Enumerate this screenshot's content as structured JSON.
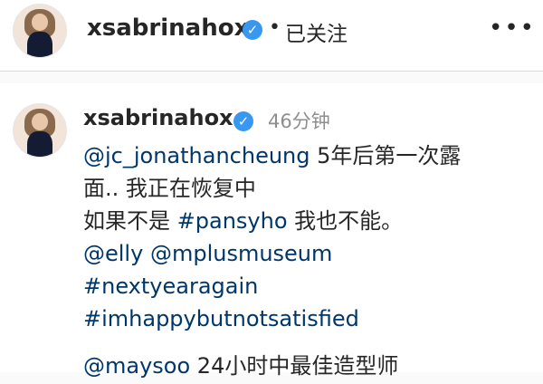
{
  "post_header": {
    "username": "xsabrinahox",
    "verified_glyph": "✓",
    "separator": "•",
    "follow_status": "已关注",
    "more_glyph": "•••"
  },
  "comment": {
    "username": "xsabrinahox",
    "verified_glyph": "✓",
    "timestamp": "46分钟",
    "line1": {
      "mention": "@jc_jonathancheung",
      "text": " 5年后第一次露"
    },
    "line2": {
      "text": "面.. 我正在恢复中"
    },
    "line3": {
      "before": "如果不是 ",
      "hashtag": "#pansyho",
      "after": " 我也不能。"
    },
    "line4": {
      "mention1": "@elly",
      "space": " ",
      "mention2": "@mplusmuseum"
    },
    "line5": {
      "hashtag": "#nextyearagain"
    },
    "line6": {
      "hashtag": "#imhappybutnotsatisfied"
    },
    "line7": {
      "mention": "@maysoo",
      "text": " 24小时中最佳造型师"
    }
  },
  "colors": {
    "link": "#00376b",
    "verified": "#3897f0",
    "timestamp": "#8e8e8e",
    "text": "#262626",
    "background": "#fafafa"
  },
  "icons": {
    "verified": "verified-badge-icon",
    "more": "more-options-icon"
  }
}
